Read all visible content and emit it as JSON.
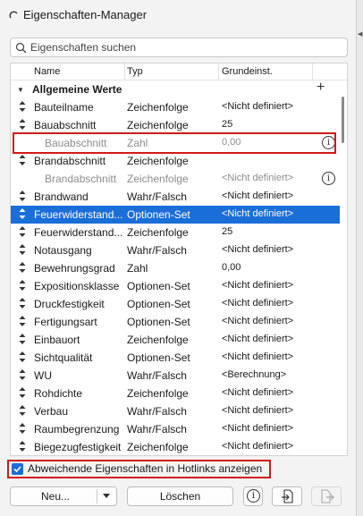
{
  "window": {
    "title": "Eigenschaften-Manager"
  },
  "search": {
    "placeholder": "Eigenschaften suchen"
  },
  "table": {
    "columns": [
      "Name",
      "Typ",
      "Grundeinst."
    ],
    "group": {
      "label": "Allgemeine Werte",
      "add_symbol": "+"
    },
    "rows": [
      {
        "name": "Bauteilname",
        "type": "Zeichenfolge",
        "default": "<Nicht definiert>",
        "state": "normal"
      },
      {
        "name": "Bauabschnitt",
        "type": "Zeichenfolge",
        "default": "25",
        "state": "normal"
      },
      {
        "name": "Bauabschnitt",
        "type": "Zahl",
        "default": "0,00",
        "state": "disabled",
        "indent": true,
        "info": true
      },
      {
        "name": "Brandabschnitt",
        "type": "Zeichenfolge",
        "default": "",
        "state": "normal"
      },
      {
        "name": "Brandabschnitt",
        "type": "Zeichenfolge",
        "default": "<Nicht definiert>",
        "state": "disabled",
        "indent": true,
        "info": true
      },
      {
        "name": "Brandwand",
        "type": "Wahr/Falsch",
        "default": "<Nicht definiert>",
        "state": "normal"
      },
      {
        "name": "Feuerwiderstand...",
        "type": "Optionen-Set",
        "default": "<Nicht definiert>",
        "state": "selected"
      },
      {
        "name": "Feuerwiderstand...",
        "type": "Zeichenfolge",
        "default": "25",
        "state": "normal"
      },
      {
        "name": "Notausgang",
        "type": "Wahr/Falsch",
        "default": "<Nicht definiert>",
        "state": "normal"
      },
      {
        "name": "Bewehrungsgrad",
        "type": "Zahl",
        "default": "0,00",
        "state": "normal"
      },
      {
        "name": "Expositionsklasse",
        "type": "Optionen-Set",
        "default": "<Nicht definiert>",
        "state": "normal"
      },
      {
        "name": "Druckfestigkeit",
        "type": "Optionen-Set",
        "default": "<Nicht definiert>",
        "state": "normal"
      },
      {
        "name": "Fertigungsart",
        "type": "Optionen-Set",
        "default": "<Nicht definiert>",
        "state": "normal"
      },
      {
        "name": "Einbauort",
        "type": "Zeichenfolge",
        "default": "<Nicht definiert>",
        "state": "normal"
      },
      {
        "name": "Sichtqualität",
        "type": "Optionen-Set",
        "default": "<Nicht definiert>",
        "state": "normal"
      },
      {
        "name": "WU",
        "type": "Wahr/Falsch",
        "default": "<Berechnung>",
        "state": "normal"
      },
      {
        "name": "Rohdichte",
        "type": "Zeichenfolge",
        "default": "<Nicht definiert>",
        "state": "normal"
      },
      {
        "name": "Verbau",
        "type": "Wahr/Falsch",
        "default": "<Nicht definiert>",
        "state": "normal"
      },
      {
        "name": "Raumbegrenzung",
        "type": "Wahr/Falsch",
        "default": "<Nicht definiert>",
        "state": "normal"
      },
      {
        "name": "Biegezugfestigkeit",
        "type": "Zeichenfolge",
        "default": "<Nicht definiert>",
        "state": "normal"
      }
    ]
  },
  "hotlinks_checkbox": {
    "label": "Abweichende Eigenschaften in Hotlinks anzeigen",
    "checked": true
  },
  "buttons": {
    "new_label": "Neu...",
    "delete_label": "Löschen",
    "info_symbol": "i"
  },
  "colors": {
    "selection": "#1a6ed8",
    "highlight_border": "#d11a1a"
  }
}
